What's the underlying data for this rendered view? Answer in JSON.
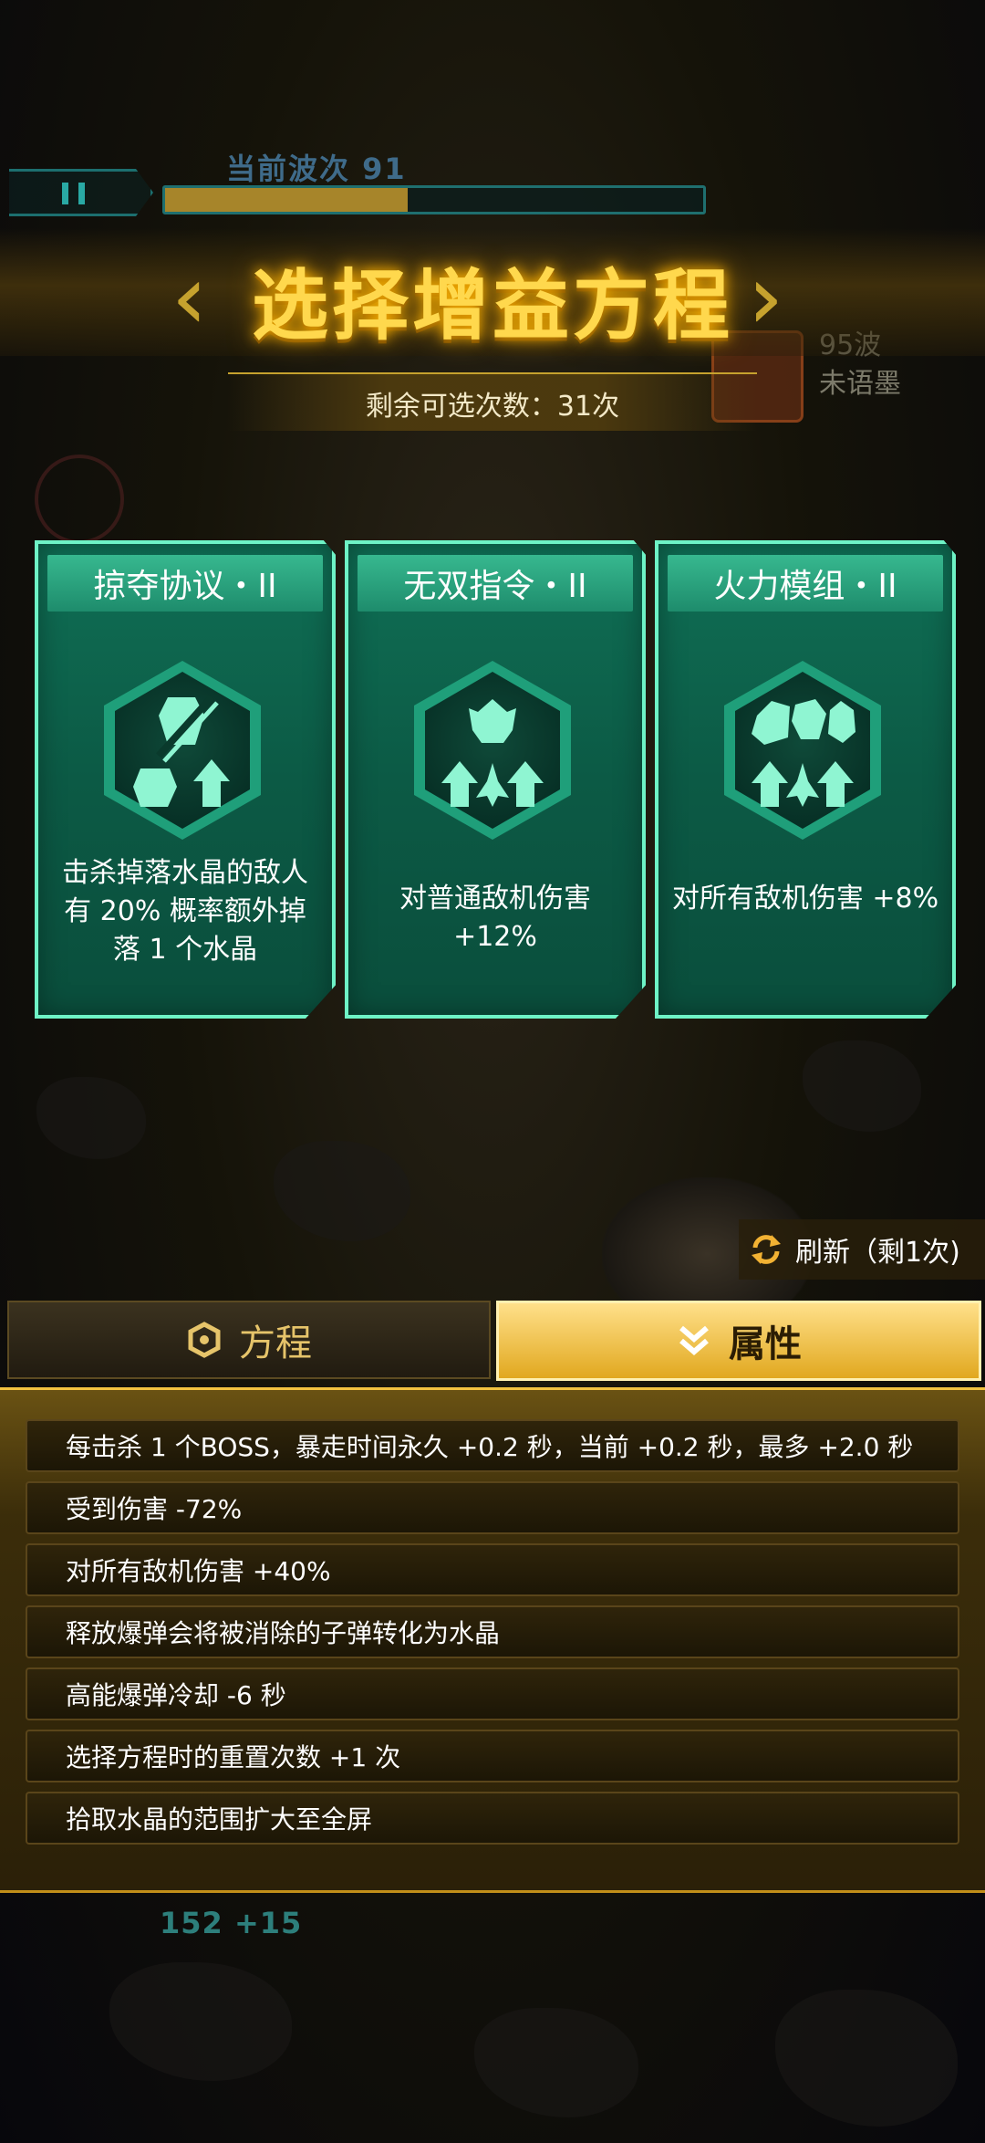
{
  "hud": {
    "wave_label": "当前波次 91",
    "wave_progress": 0.45,
    "ally_wave": "95波",
    "ally_name": "未语墨",
    "bottom_stat": "152 +15"
  },
  "title": "选择增益方程",
  "remaining": "剩余可选次数：31次",
  "cards": [
    {
      "name": "掠夺协议・II",
      "icon": "crystal-drop-icon",
      "desc": "击杀掉落水晶的敌人有 20% 概率额外掉落 1 个水晶"
    },
    {
      "name": "无双指令・II",
      "icon": "fighter-damage-up-icon",
      "desc": "对普通敌机伤害 +12%"
    },
    {
      "name": "火力模组・II",
      "icon": "all-enemies-damage-up-icon",
      "desc": "对所有敌机伤害 +8%"
    }
  ],
  "refresh": {
    "label": "刷新（剩1次)",
    "icon": "refresh-icon"
  },
  "tabs": {
    "equations": "方程",
    "attributes": "属性",
    "active": "attributes"
  },
  "attributes": [
    "每击杀 1 个BOSS，暴走时间永久 +0.2 秒，当前 +0.2 秒，最多 +2.0 秒",
    "受到伤害 -72%",
    "对所有敌机伤害 +40%",
    "释放爆弹会将被消除的子弹转化为水晶",
    "高能爆弹冷却 -6 秒",
    "选择方程时的重置次数 +1 次",
    "拾取水晶的范围扩大至全屏"
  ],
  "colors": {
    "gold": "#ffd84d",
    "card_border": "#6ef3c6",
    "card_fill": "#0c5a45",
    "tab_active": "#e1a81f"
  }
}
